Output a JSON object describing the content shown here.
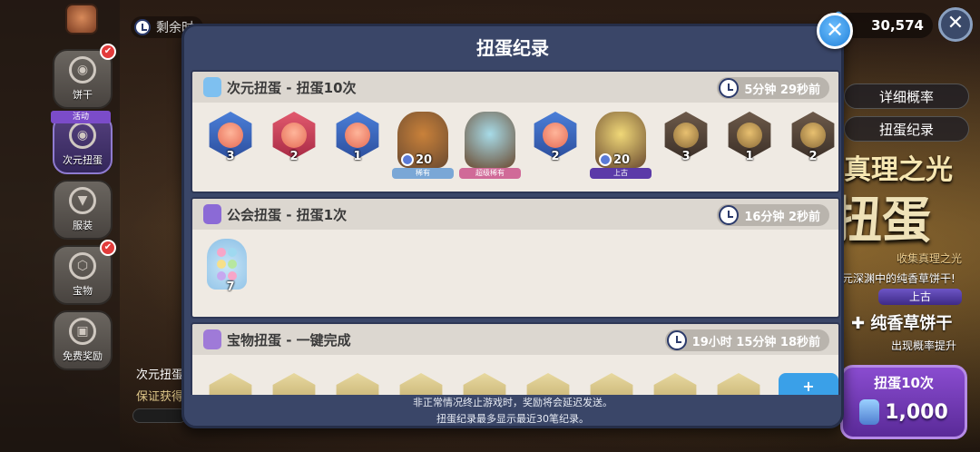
{
  "sidebar": {
    "items": [
      {
        "label": "饼干",
        "badge": "✔"
      },
      {
        "label": "次元扭蛋",
        "tag": "活动"
      },
      {
        "label": "服装"
      },
      {
        "label": "宝物",
        "badge": "✔"
      },
      {
        "label": "免费奖励"
      }
    ]
  },
  "topbar": {
    "remain_label": "剩余时",
    "crystals": "30,574"
  },
  "right_panel": {
    "detail_rate": "详细概率",
    "gacha_record": "扭蛋纪录",
    "event_title": "真理之光",
    "big_title": "扭蛋",
    "collect": "收集真理之光",
    "deep": "元深渊中的纯香草饼干!",
    "ancient": "上古",
    "plus_cookie": "✚ 纯香草饼干",
    "rate_up": "出现概率提升",
    "pull10_label": "扭蛋10次",
    "pull10_cost": "1,000"
  },
  "left_bottom": {
    "line1": "次元扭蛋",
    "line2": "保证获得"
  },
  "modal": {
    "title": "扭蛋纪录",
    "records": [
      {
        "name": "次元扭蛋 - 扭蛋10次",
        "time": "5分钟 29秒前",
        "type_color": "#7ec0f0",
        "items": [
          {
            "style": "blue",
            "count": "3"
          },
          {
            "style": "red",
            "count": "2"
          },
          {
            "style": "blue",
            "count": "1"
          },
          {
            "style": "cookie",
            "count": "20",
            "tag": "稀有",
            "tag_color": "#7aa7d6",
            "cookie_color": "#c9813a"
          },
          {
            "style": "cookie",
            "count": "",
            "tag": "超级稀有",
            "tag_color": "#d06a98",
            "cookie_color": "#a7dbe8"
          },
          {
            "style": "blue",
            "count": "2"
          },
          {
            "style": "cookie",
            "count": "20",
            "tag": "上古",
            "tag_color": "#5b3aa8",
            "cookie_color": "#f0d878"
          },
          {
            "style": "dark",
            "count": "3"
          },
          {
            "style": "dark",
            "count": "1"
          },
          {
            "style": "dark",
            "count": "2"
          }
        ]
      },
      {
        "name": "公会扭蛋 - 扭蛋1次",
        "time": "16分钟 2秒前",
        "type_color": "#8b6ad6",
        "items": [
          {
            "style": "bag",
            "count": "7"
          }
        ]
      },
      {
        "name": "宝物扭蛋 - 一键完成",
        "time": "19小时 15分钟 18秒前",
        "type_color": "#9f7ad8",
        "items": [
          {
            "style": "gold"
          },
          {
            "style": "gold"
          },
          {
            "style": "gold"
          },
          {
            "style": "gold"
          },
          {
            "style": "gold"
          },
          {
            "style": "gold"
          },
          {
            "style": "gold"
          },
          {
            "style": "gold"
          },
          {
            "style": "gold"
          }
        ],
        "more_label": "+"
      }
    ],
    "footer_line1": "非正常情况终止游戏时，奖励将会延迟发送。",
    "footer_line2": "扭蛋纪录最多显示最近30笔纪录。"
  }
}
